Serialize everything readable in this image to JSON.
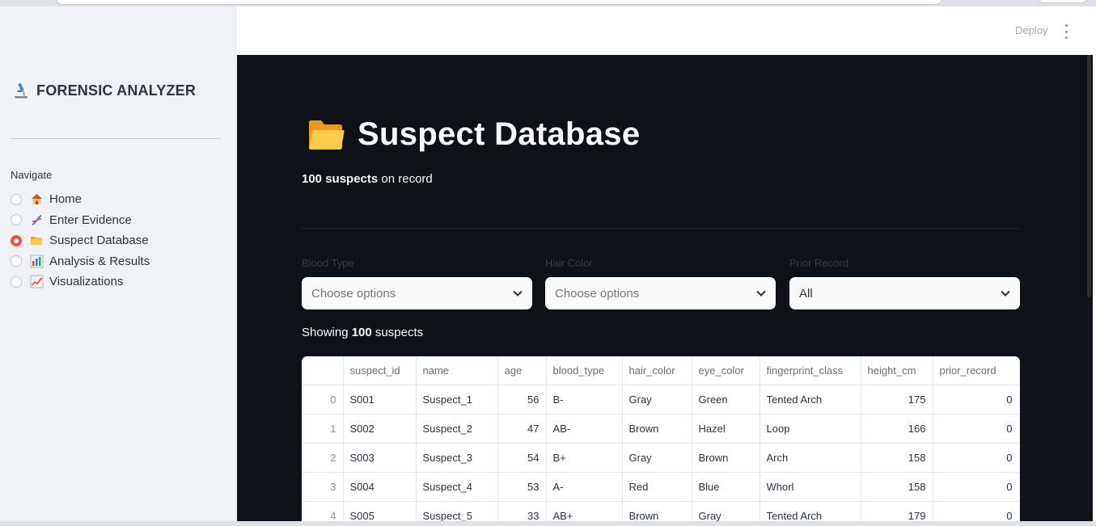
{
  "app": {
    "brand_title": "FORENSIC ANALYZER",
    "brand_icon": "microscope-icon"
  },
  "header": {
    "deploy_label": "Deploy",
    "menu_icon": "kebab-menu-icon"
  },
  "sidebar": {
    "navigate_label": "Navigate",
    "items": [
      {
        "label": "Home",
        "icon": "house-icon",
        "selected": false
      },
      {
        "label": "Enter Evidence",
        "icon": "dna-icon",
        "selected": false
      },
      {
        "label": "Suspect Database",
        "icon": "folder-icon",
        "selected": true
      },
      {
        "label": "Analysis & Results",
        "icon": "bar-chart-icon",
        "selected": false
      },
      {
        "label": "Visualizations",
        "icon": "trend-chart-icon",
        "selected": false
      }
    ]
  },
  "main": {
    "title": "Suspect Database",
    "title_icon": "folder-icon",
    "record_count": "100 suspects",
    "record_suffix": " on record",
    "filters": [
      {
        "label": "Blood Type",
        "value": "Choose options",
        "is_placeholder": true
      },
      {
        "label": "Hair Color",
        "value": "Choose options",
        "is_placeholder": true
      },
      {
        "label": "Prior Record",
        "value": "All",
        "is_placeholder": false
      }
    ],
    "showing_prefix": "Showing ",
    "showing_count": "100",
    "showing_suffix": " suspects"
  },
  "table": {
    "columns": [
      "",
      "suspect_id",
      "name",
      "age",
      "blood_type",
      "hair_color",
      "eye_color",
      "fingerprint_class",
      "height_cm",
      "prior_record"
    ],
    "rows": [
      [
        "0",
        "S001",
        "Suspect_1",
        "56",
        "B-",
        "Gray",
        "Green",
        "Tented Arch",
        "175",
        "0"
      ],
      [
        "1",
        "S002",
        "Suspect_2",
        "47",
        "AB-",
        "Brown",
        "Hazel",
        "Loop",
        "166",
        "0"
      ],
      [
        "2",
        "S003",
        "Suspect_3",
        "54",
        "B+",
        "Gray",
        "Brown",
        "Arch",
        "158",
        "0"
      ],
      [
        "3",
        "S004",
        "Suspect_4",
        "53",
        "A-",
        "Red",
        "Blue",
        "Whorl",
        "158",
        "0"
      ],
      [
        "4",
        "S005",
        "Suspect_5",
        "33",
        "AB+",
        "Brown",
        "Gray",
        "Tented Arch",
        "179",
        "0"
      ]
    ]
  },
  "colors": {
    "accent": "#ff4b4b",
    "main_bg": "#0e1117",
    "sidebar_bg": "#f0f2f6"
  }
}
